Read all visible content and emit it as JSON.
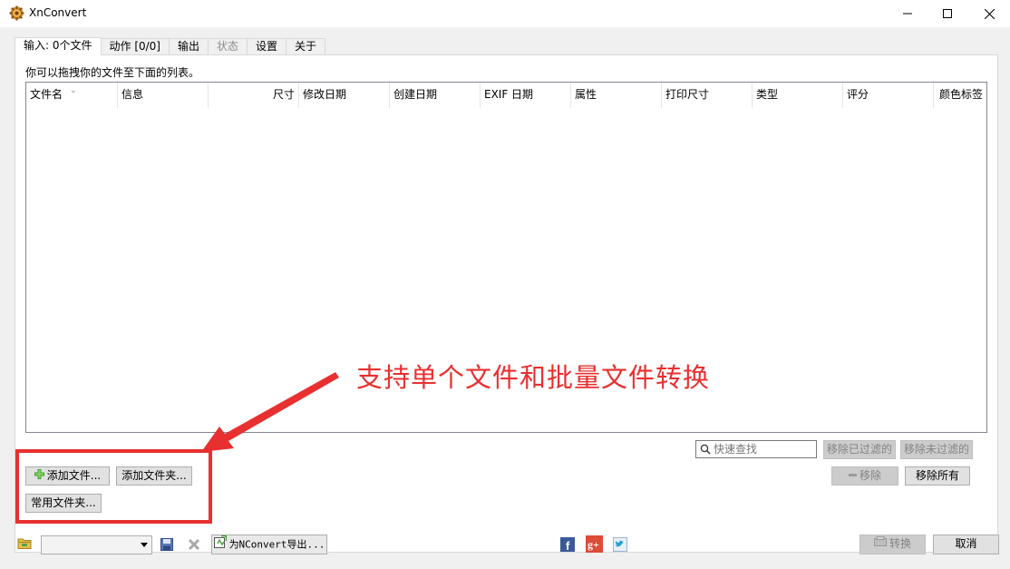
{
  "window": {
    "title": "XnConvert"
  },
  "tabs": [
    {
      "label": "输入: 0个文件",
      "state": "active"
    },
    {
      "label": "动作 [0/0]",
      "state": "normal"
    },
    {
      "label": "输出",
      "state": "normal"
    },
    {
      "label": "状态",
      "state": "disabled"
    },
    {
      "label": "设置",
      "state": "normal"
    },
    {
      "label": "关于",
      "state": "normal"
    }
  ],
  "input_panel": {
    "hint": "你可以拖拽你的文件至下面的列表。",
    "columns": [
      "文件名",
      "信息",
      "尺寸",
      "修改日期",
      "创建日期",
      "EXIF 日期",
      "属性",
      "打印尺寸",
      "类型",
      "评分",
      "颜色标签"
    ],
    "search_placeholder": "快速查找",
    "remove_filtered_label": "移除已过滤的",
    "remove_unfiltered_label": "移除未过滤的",
    "remove_label": "移除",
    "remove_all_label": "移除所有",
    "add_files_label": "添加文件...",
    "add_folder_label": "添加文件夹...",
    "common_folders_label": "常用文件夹..."
  },
  "annotation": {
    "text": "支持单个文件和批量文件转换",
    "color": "#e83030"
  },
  "bottom_bar": {
    "preset_value": "",
    "export_label": "为NConvert导出...",
    "convert_label": "转换",
    "cancel_label": "取消"
  },
  "icons": [
    "app-logo-icon",
    "minimize-icon",
    "maximize-icon",
    "close-icon",
    "search-icon",
    "add-icon",
    "remove-icon",
    "open-folder-icon",
    "save-icon",
    "delete-icon",
    "export-icon",
    "facebook-icon",
    "google-plus-icon",
    "twitter-icon",
    "convert-icon"
  ]
}
